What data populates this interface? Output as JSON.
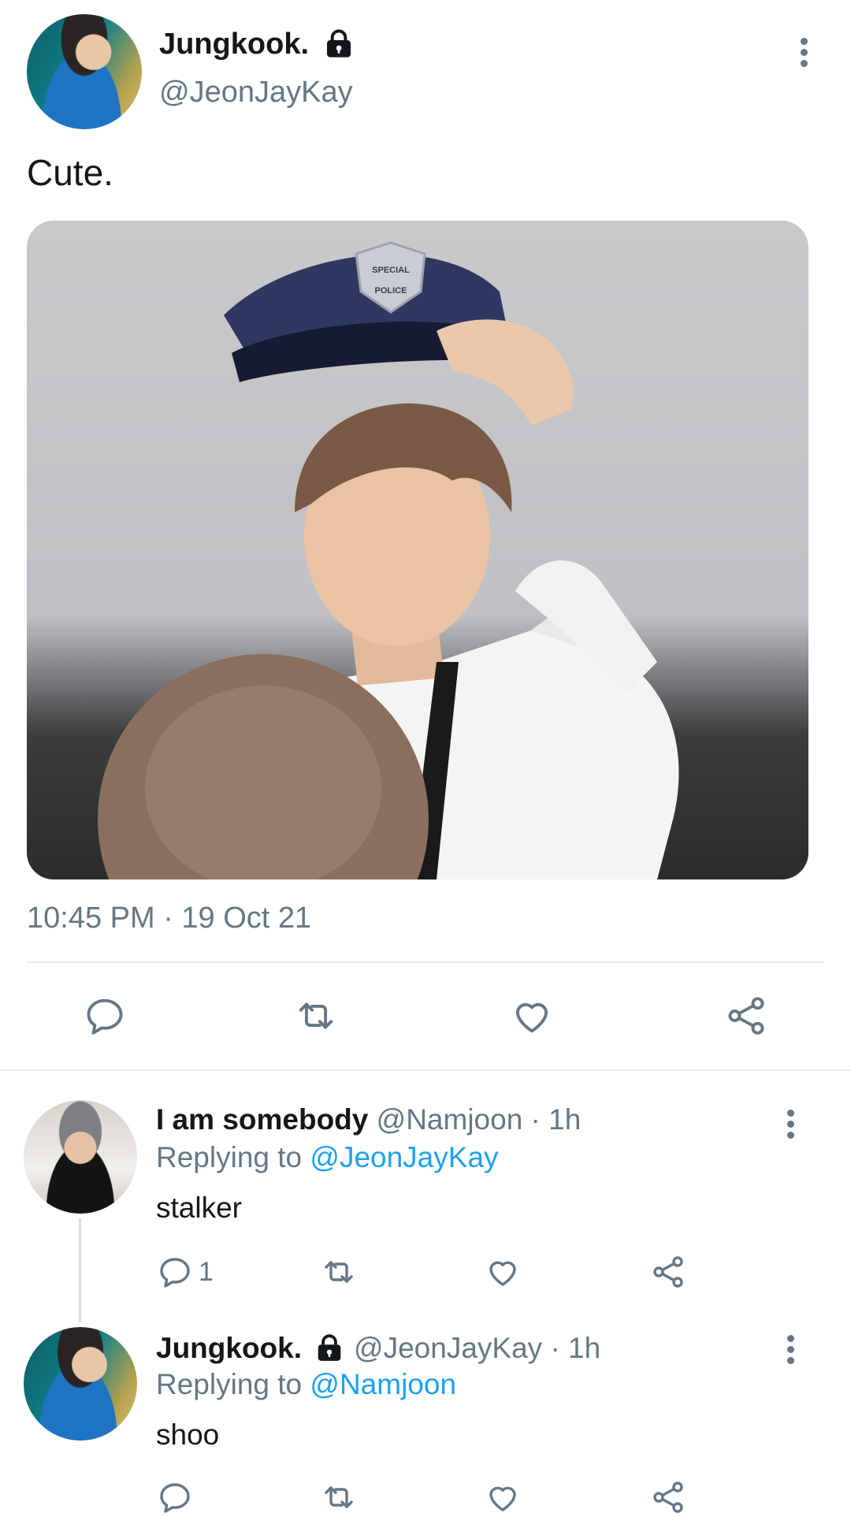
{
  "tweet": {
    "author_name": "Jungkook.",
    "author_handle": "@JeonJayKay",
    "text": "Cute.",
    "timestamp": "10:45 PM · 19 Oct 21",
    "photo_badge_text": [
      "SPECIAL",
      "POLICE"
    ]
  },
  "actions": {
    "reply": "reply-icon",
    "retweet": "retweet-icon",
    "like": "like-icon",
    "share": "share-icon"
  },
  "replies": [
    {
      "author_name": "I am somebody",
      "meta": "@Namjoon · 1h",
      "replying_label": "Replying to",
      "replying_to": "@JeonJayKay",
      "text": "stalker",
      "reply_count": "1"
    },
    {
      "author_name": "Jungkook.",
      "meta": "@JeonJayKay · 1h",
      "replying_label": "Replying to",
      "replying_to": "@Namjoon",
      "text": "shoo",
      "reply_count": ""
    }
  ],
  "colors": {
    "text": "#14171a",
    "muted": "#657786",
    "link": "#1da1f2",
    "divider": "#e6ecf0"
  }
}
